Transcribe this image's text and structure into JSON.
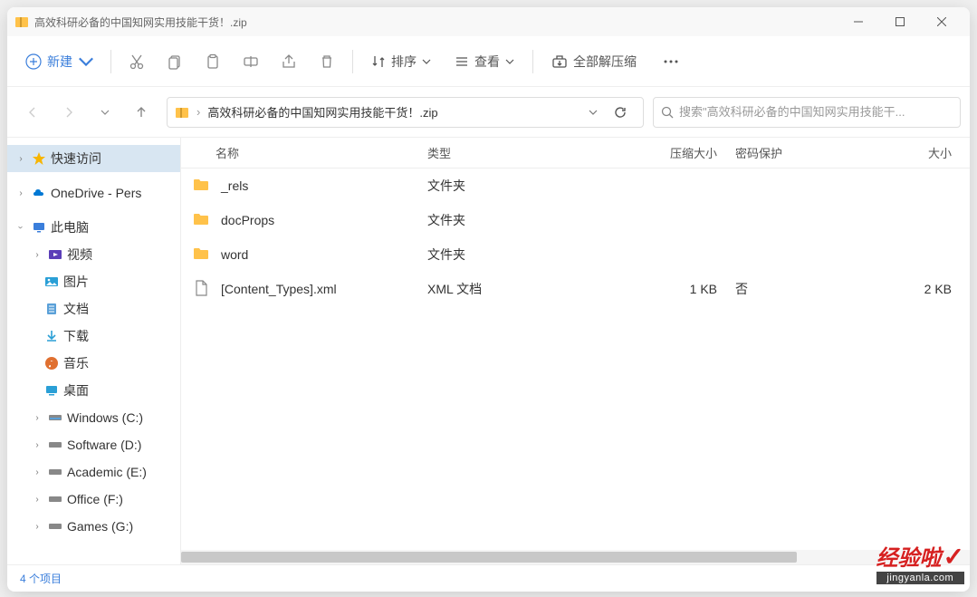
{
  "titlebar": {
    "title": "高效科研必备的中国知网实用技能干货！.zip"
  },
  "toolbar": {
    "new_label": "新建",
    "sort_label": "排序",
    "view_label": "查看",
    "extract_label": "全部解压缩"
  },
  "address": {
    "path": "高效科研必备的中国知网实用技能干货！.zip"
  },
  "search": {
    "placeholder": "搜索\"高效科研必备的中国知网实用技能干..."
  },
  "sidebar": {
    "quick": "快速访问",
    "onedrive": "OneDrive - Pers",
    "thispc": "此电脑",
    "videos": "视频",
    "pictures": "图片",
    "documents": "文档",
    "downloads": "下载",
    "music": "音乐",
    "desktop": "桌面",
    "drive_c": "Windows (C:)",
    "drive_d": "Software (D:)",
    "drive_e": "Academic (E:)",
    "drive_f": "Office (F:)",
    "drive_g": "Games (G:)"
  },
  "columns": {
    "name": "名称",
    "type": "类型",
    "compressed": "压缩大小",
    "password": "密码保护",
    "size": "大小"
  },
  "files": [
    {
      "name": "_rels",
      "type": "文件夹",
      "compressed": "",
      "password": "",
      "size": "",
      "icon": "folder"
    },
    {
      "name": "docProps",
      "type": "文件夹",
      "compressed": "",
      "password": "",
      "size": "",
      "icon": "folder"
    },
    {
      "name": "word",
      "type": "文件夹",
      "compressed": "",
      "password": "",
      "size": "",
      "icon": "folder"
    },
    {
      "name": "[Content_Types].xml",
      "type": "XML 文档",
      "compressed": "1 KB",
      "password": "否",
      "size": "2 KB",
      "icon": "file"
    }
  ],
  "status": {
    "items": "4 个项目"
  },
  "watermark": {
    "top": "经验啦",
    "bottom": "jingyanla.com"
  }
}
